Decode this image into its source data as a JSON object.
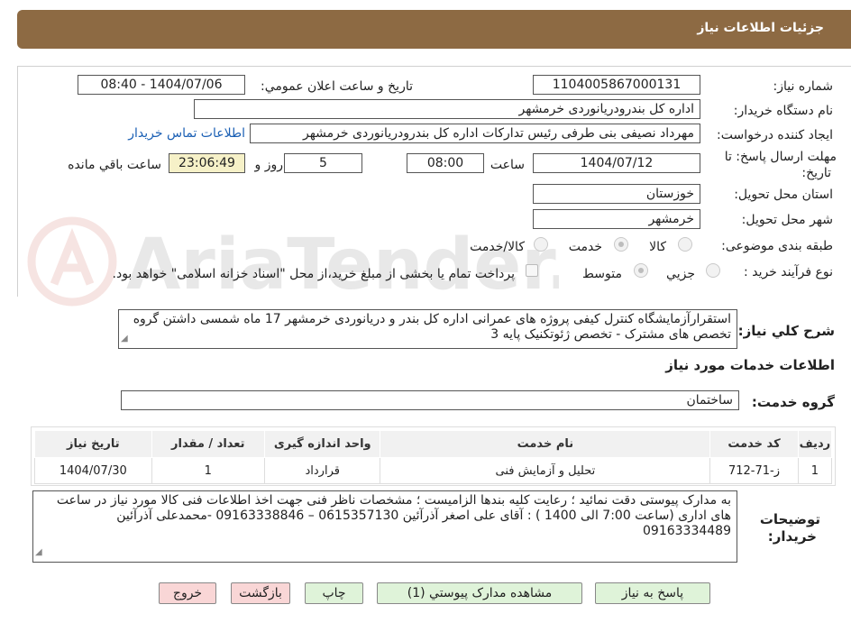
{
  "header": {
    "title": "جزئیات اطلاعات نیاز"
  },
  "form": {
    "need_number_label": "شماره نیاز:",
    "need_number": "1104005867000131",
    "announce_label": "تاریخ و ساعت اعلان عمومي:",
    "announce_value": "1404/07/06 - 08:40",
    "buyer_org_label": "نام دستگاه خریدار:",
    "buyer_org": "اداره کل بندرودریانوردی خرمشهر",
    "requester_label": "ایجاد کننده درخواست:",
    "requester": "مهرداد  نصیفی بنی طرفی رئیس تدارکات اداره کل بندرودریانوردی خرمشهر",
    "contact_link": "اطلاعات تماس خریدار",
    "deadline_label_1": "مهلت ارسال پاسخ: تا",
    "deadline_label_2": "تاریخ:",
    "deadline_date": "1404/07/12",
    "time_label": "ساعت",
    "deadline_time": "08:00",
    "days": "5",
    "days_label": "روز و",
    "remaining": "23:06:49",
    "remaining_label": "ساعت باقي مانده",
    "province_label": "استان محل تحویل:",
    "province": "خوزستان",
    "city_label": "شهر محل تحویل:",
    "city": "خرمشهر",
    "category_label": "طبقه بندی موضوعی:",
    "category_options": [
      "کالا",
      "خدمت",
      "کالا/خدمت"
    ],
    "category_selected": "خدمت",
    "process_label": "نوع فرآیند خرید :",
    "process_options": [
      "جزیي",
      "متوسط"
    ],
    "process_selected": "متوسط",
    "payment_note": "پرداخت تمام یا بخشی از مبلغ خرید،از محل \"اسناد خزانه اسلامی\" خواهد بود."
  },
  "description": {
    "label": "شرح کلي نیاز:",
    "text": "استقرارآزمایشگاه کنترل کیفی پروژه های عمرانی اداره کل بندر و دریانوردی خرمشهر 17 ماه شمسی داشتن گروه تخصص های مشترک - تخصص ژئوتکنیک پایه 3"
  },
  "services": {
    "title": "اطلاعات خدمات مورد نیاز",
    "group_label": "گروه خدمت:",
    "group_value": "ساختمان",
    "columns": [
      "ردیف",
      "کد خدمت",
      "نام خدمت",
      "واحد اندازه گیری",
      "تعداد / مقدار",
      "تاریخ نیاز"
    ],
    "rows": [
      [
        "1",
        "ز-71-712",
        "تحلیل و آزمایش فنی",
        "قرارداد",
        "1",
        "1404/07/30"
      ]
    ]
  },
  "buyer_notes": {
    "label_1": "توضیحات",
    "label_2": "خریدار:",
    "text": "به مدارک پیوستی دقت نمائید ؛ رعایت کلیه بندها الزامیست ؛ مشخصات ناظر فنی جهت اخذ اطلاعات فنی کالا مورد نیاز در ساعت های اداری (ساعت 7:00 الی 1400 ) : آقای علی اصغر آذرآئین 0615357130 – 09163338846 -محمدعلی آذرآئین 09163334489"
  },
  "buttons": {
    "respond": "پاسخ به نیاز",
    "attachments": "مشاهده مدارک پیوستي (1)",
    "print": "چاپ",
    "back": "بازگشت",
    "exit": "خروج"
  },
  "watermark": {
    "text": "AriaTender.neT"
  },
  "colors": {
    "header_bg": "#8d6a43",
    "link": "#1a5fb4",
    "button_green": "#dff3d9",
    "button_red": "#f9d6d6",
    "remaining_bg": "#f6f1c8"
  }
}
